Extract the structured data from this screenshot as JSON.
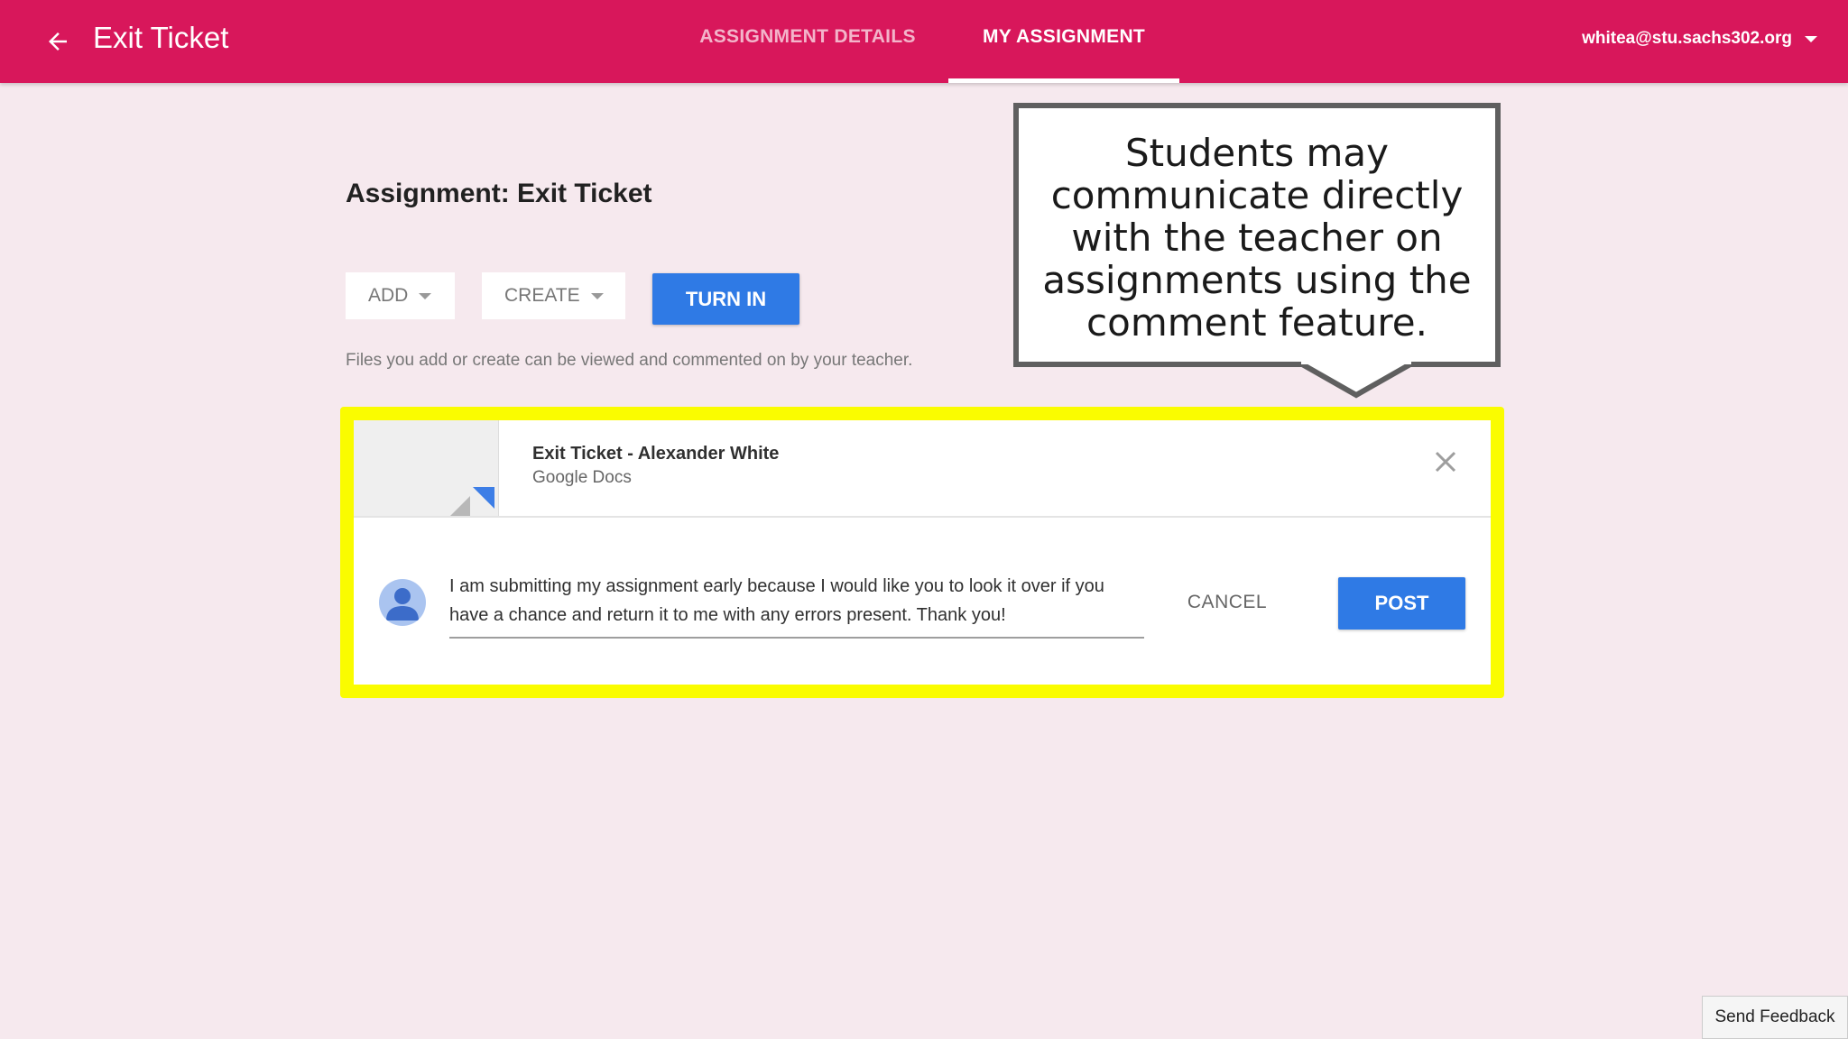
{
  "header": {
    "title": "Exit Ticket",
    "back_icon": "arrow-left-icon",
    "tabs": [
      {
        "label": "ASSIGNMENT DETAILS",
        "active": false
      },
      {
        "label": "MY ASSIGNMENT",
        "active": true
      }
    ],
    "account": "whitea@stu.sachs302.org",
    "color": "#d8175b"
  },
  "main": {
    "heading": "Assignment: Exit Ticket",
    "add_label": "ADD",
    "create_label": "CREATE",
    "turn_in_label": "TURN IN",
    "hint": "Files you add or create can be viewed and commented on by your teacher."
  },
  "attachment": {
    "name": "Exit Ticket - Alexander White",
    "type": "Google Docs",
    "remove_icon": "close-icon"
  },
  "comment": {
    "text": "I am submitting my assignment early because I would like you to look it over if you have a chance and return it to me with any errors present. Thank you!",
    "cancel_label": "CANCEL",
    "post_label": "POST"
  },
  "callout": {
    "text": "Students may communicate directly with the teacher on assignments using the comment feature."
  },
  "footer": {
    "feedback_label": "Send Feedback"
  },
  "colors": {
    "accent": "#2f7ae5",
    "highlight": "#fafc00",
    "background": "#f6e9ee"
  }
}
